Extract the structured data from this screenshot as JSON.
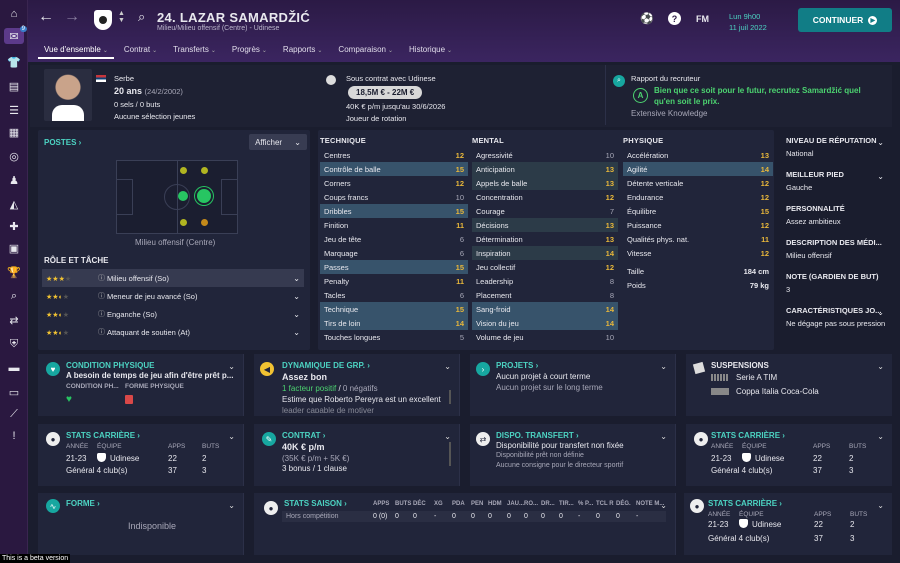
{
  "header": {
    "player_name": "24. LAZAR SAMARDŽIĆ",
    "subtitle": "Milieu/Milieu offensif (Centre) - Udinese",
    "day": "Lun 9h00",
    "date": "11 juil 2022",
    "fm": "FM",
    "continue": "CONTINUER",
    "sidebar_badge": "9"
  },
  "tabs": [
    "Vue d'ensemble",
    "Contrat",
    "Transferts",
    "Progrès",
    "Rapports",
    "Comparaison",
    "Historique"
  ],
  "profile": {
    "nationality": "Serbe",
    "age": "20 ans",
    "dob": "(24/2/2002)",
    "caps": "0 sels / 0 buts",
    "youth": "Aucune sélection jeunes"
  },
  "contract": {
    "title": "Sous contrat avec Udinese",
    "value": "18,5M € - 22M €",
    "wage": "40K € p/m jusqu'au 30/6/2026",
    "role": "Joueur de rotation"
  },
  "scout": {
    "title": "Rapport du recruteur",
    "grade": "A",
    "text": "Bien que ce soit pour le futur, recrutez Samardžić quel qu'en soit le prix.",
    "source": "Extensive Knowledge"
  },
  "positions": {
    "title": "POSTES",
    "show": "Afficher",
    "label": "Milieu offensif (Centre)",
    "role_title": "RÔLE ET TÂCHE",
    "roles": [
      {
        "name": "Milieu offensif (So)",
        "stars": 3
      },
      {
        "name": "Meneur de jeu avancé (So)",
        "stars": 2.5
      },
      {
        "name": "Enganche (So)",
        "stars": 2.5
      },
      {
        "name": "Attaquant de soutien (At)",
        "stars": 2.5
      }
    ]
  },
  "technique": {
    "title": "TECHNIQUE",
    "rows": [
      [
        "Centres",
        "12",
        ""
      ],
      [
        "Contrôle de balle",
        "15",
        "hl"
      ],
      [
        "Corners",
        "12",
        ""
      ],
      [
        "Coups francs",
        "10",
        ""
      ],
      [
        "Dribbles",
        "15",
        "hl"
      ],
      [
        "Finition",
        "11",
        ""
      ],
      [
        "Jeu de tête",
        "6",
        ""
      ],
      [
        "Marquage",
        "6",
        ""
      ],
      [
        "Passes",
        "15",
        "hl"
      ],
      [
        "Penalty",
        "11",
        ""
      ],
      [
        "Tacles",
        "6",
        ""
      ],
      [
        "Technique",
        "15",
        "hl"
      ],
      [
        "Tirs de loin",
        "14",
        "hl"
      ],
      [
        "Touches longues",
        "5",
        ""
      ]
    ]
  },
  "mental": {
    "title": "MENTAL",
    "rows": [
      [
        "Agressivité",
        "10",
        ""
      ],
      [
        "Anticipation",
        "13",
        "hl2"
      ],
      [
        "Appels de balle",
        "13",
        "hl2"
      ],
      [
        "Concentration",
        "12",
        ""
      ],
      [
        "Courage",
        "7",
        ""
      ],
      [
        "Décisions",
        "13",
        "hl2"
      ],
      [
        "Détermination",
        "13",
        ""
      ],
      [
        "Inspiration",
        "14",
        "hl2"
      ],
      [
        "Jeu collectif",
        "12",
        ""
      ],
      [
        "Leadership",
        "8",
        ""
      ],
      [
        "Placement",
        "8",
        ""
      ],
      [
        "Sang-froid",
        "14",
        "hl"
      ],
      [
        "Vision du jeu",
        "14",
        "hl"
      ],
      [
        "Volume de jeu",
        "10",
        ""
      ]
    ]
  },
  "physique": {
    "title": "PHYSIQUE",
    "rows": [
      [
        "Accélération",
        "13",
        ""
      ],
      [
        "Agilité",
        "14",
        "hl"
      ],
      [
        "Détente verticale",
        "12",
        ""
      ],
      [
        "Endurance",
        "12",
        ""
      ],
      [
        "Équilibre",
        "15",
        ""
      ],
      [
        "Puissance",
        "12",
        ""
      ],
      [
        "Qualités phys. nat.",
        "11",
        ""
      ],
      [
        "Vitesse",
        "12",
        ""
      ]
    ],
    "height_label": "Taille",
    "height": "184 cm",
    "weight_label": "Poids",
    "weight": "79 kg"
  },
  "side": [
    [
      "NIVEAU DE RÉPUTATION",
      "National"
    ],
    [
      "MEILLEUR PIED",
      "Gauche"
    ],
    [
      "PERSONNALITÉ",
      "Assez ambitieux"
    ],
    [
      "DESCRIPTION DES MÉDI...",
      "Milieu offensif"
    ],
    [
      "NOTE (GARDIEN DE BUT)",
      "3"
    ],
    [
      "CARACTÉRISTIQUES JO...",
      "Ne dégage pas sous pression"
    ]
  ],
  "cards": {
    "condition": {
      "title": "CONDITION PHYSIQUE",
      "text": "A besoin de temps de jeu afin d'être prêt p...",
      "col1": "CONDITION PH...",
      "col2": "FORME PHYSIQUE"
    },
    "dynamics": {
      "title": "DYNAMIQUE DE GRP.",
      "text": "Assez bon",
      "pos": "1 facteur positif",
      "neg": "0 négatifs",
      "note": "Estime que Roberto Pereyra est un excellent",
      "note2": "leader capable de motiver"
    },
    "projects": {
      "title": "PROJETS",
      "text": "Aucun projet à court terme",
      "text2": "Aucun projet sur le long terme"
    },
    "suspensions": {
      "title": "SUSPENSIONS",
      "c1": "Serie A TIM",
      "c2": "Coppa Italia Coca-Cola"
    },
    "career": {
      "title": "STATS CARRIÈRE",
      "h": [
        "ANNÉE",
        "ÉQUIPE",
        "APPS",
        "BUTS"
      ],
      "r1": [
        "21-23",
        "Udinese",
        "22",
        "2"
      ],
      "r2": [
        "Général 4 club(s)",
        "37",
        "3"
      ]
    },
    "contract2": {
      "title": "CONTRAT",
      "wage": "40K € p/m",
      "bonus": "(35K € p/m + 5K €)",
      "clause": "3 bonus / 1 clause"
    },
    "transfer": {
      "title": "DISPO. TRANSFERT",
      "text": "Disponibilité pour transfert non fixée",
      "text2": "Disponibilité prêt non définie",
      "text3": "Aucune consigne pour le directeur sportif"
    },
    "form": {
      "title": "FORME",
      "text": "Indisponible"
    },
    "season": {
      "title": "STATS SAISON",
      "cols": [
        "APPS",
        "BUTS",
        "DÉC",
        "XG",
        "PDA",
        "PEN",
        "HDM",
        "JAU...",
        "RO...",
        "DR...",
        "TIR...",
        "% P...",
        "TCL R",
        "DÉG.",
        "NOTE M..."
      ],
      "row_label": "Hors compétition",
      "row": [
        "0 (0)",
        "0",
        "0",
        "-",
        "0",
        "0",
        "0",
        "0",
        "0",
        "0",
        "0",
        "-",
        "0",
        "0",
        "-"
      ]
    }
  },
  "beta": "This is a beta version"
}
